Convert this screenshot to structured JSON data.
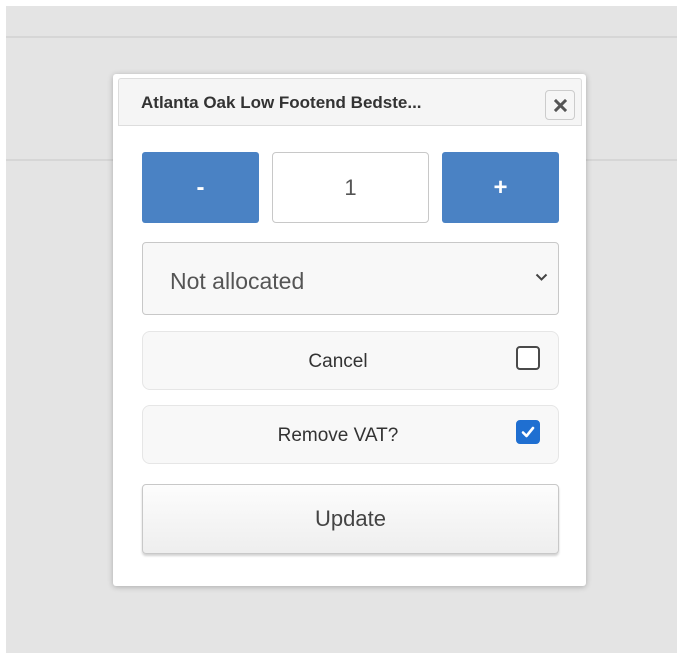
{
  "dialog": {
    "title": "Atlanta Oak Low Footend Bedste...",
    "close_icon": "close-icon"
  },
  "quantity": {
    "minus_label": "-",
    "value": "1",
    "plus_label": "+",
    "button_color": "#4a82c4"
  },
  "allocation": {
    "selected": "Not allocated",
    "chevron_icon": "chevron-down-icon"
  },
  "options": {
    "cancel": {
      "label": "Cancel",
      "checked": false
    },
    "remove_vat": {
      "label": "Remove VAT?",
      "checked": true,
      "check_color": "#1f6fd1"
    }
  },
  "actions": {
    "update_label": "Update"
  }
}
